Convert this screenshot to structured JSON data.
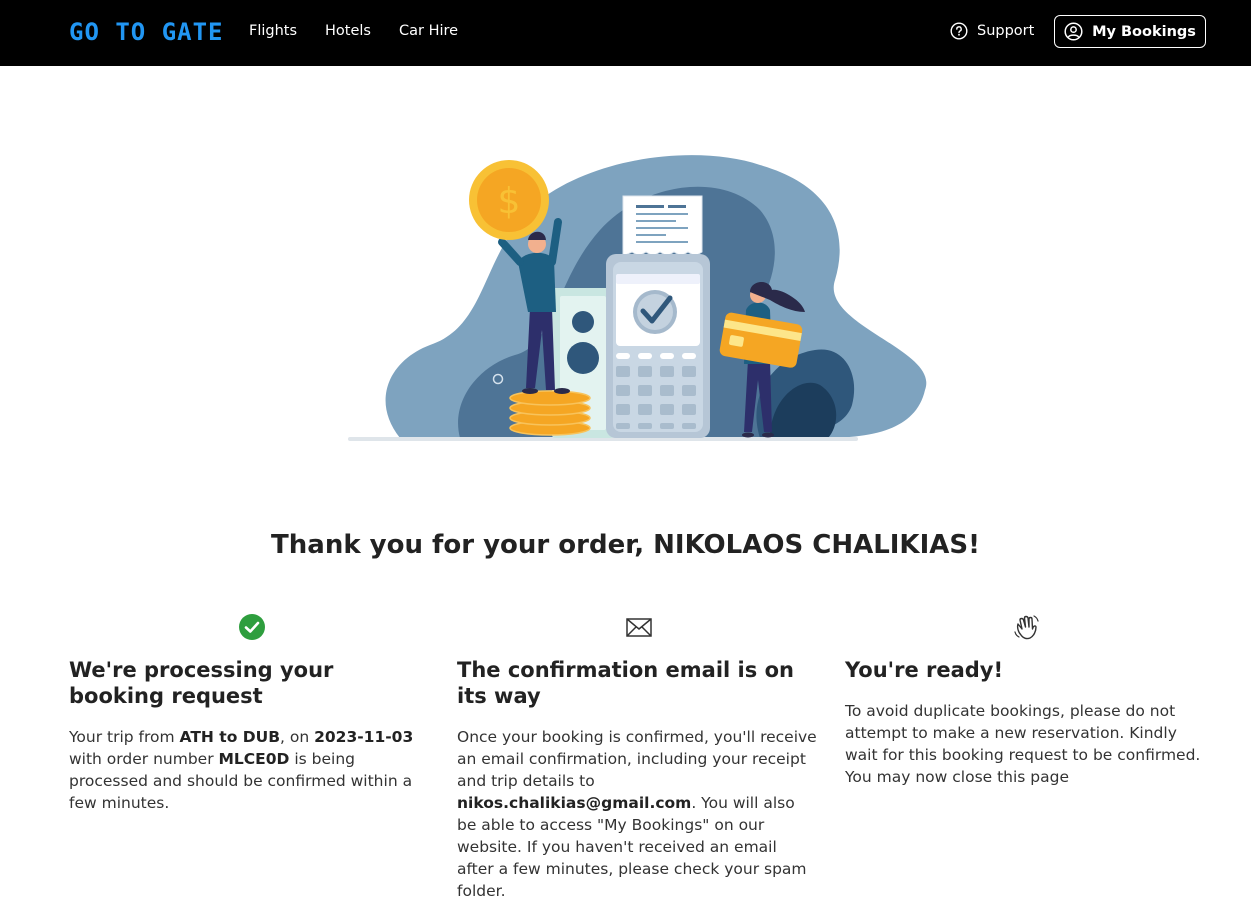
{
  "header": {
    "logo": "GO TO GATE",
    "nav": [
      "Flights",
      "Hotels",
      "Car Hire"
    ],
    "support_label": "Support",
    "my_bookings_label": "My Bookings"
  },
  "colors": {
    "accent": "#2196f3",
    "success": "#2e9e3e",
    "header_bg": "#000000"
  },
  "headline": "Thank you for your order, NIKOLAOS CHALIKIAS!",
  "steps": [
    {
      "icon": "check-circle-icon",
      "title": "We're processing your booking request",
      "route": "ATH to DUB",
      "date": "2023-11-03",
      "order_number": "MLCE0D",
      "t1": "Your trip from ",
      "t2": ", on ",
      "t3": " with order number ",
      "t4": " is being processed and should be confirmed within a few minutes."
    },
    {
      "icon": "envelope-icon",
      "title": "The confirmation email is on its way",
      "email": "nikos.chalikias@gmail.com",
      "t1": "Once your booking is confirmed, you'll receive an email confirmation, including your receipt and trip details to ",
      "t2": ". You will also be able to access \"My Bookings\" on our website. If you haven't received an email after a few minutes, please check your spam folder."
    },
    {
      "icon": "waving-hand-icon",
      "title": "You're ready!",
      "text": "To avoid duplicate bookings, please do not attempt to make a new reservation. Kindly wait for this booking request to be confirmed. You may now close this page"
    }
  ]
}
